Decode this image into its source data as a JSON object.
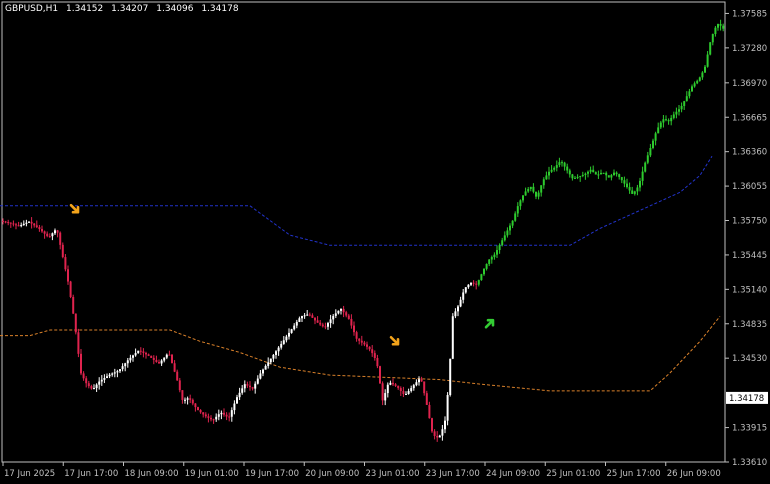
{
  "header": {
    "symbol": "GBPUSD,H1",
    "open": "1.34152",
    "high": "1.34207",
    "low": "1.34096",
    "close": "1.34178"
  },
  "colors": {
    "background": "#000000",
    "axis": "#c0c0c0",
    "bull_candle": "#ffffff",
    "bear_candle": "#e0234e",
    "uptrend_candle": "#2ecc2e",
    "upper_band": "#2233cc",
    "lower_band": "#d9802a",
    "sell_arrow": "#f2a31b",
    "buy_arrow": "#33cc33",
    "price_tag_bg": "#ffffff",
    "price_tag_text": "#000000"
  },
  "chart_data": {
    "type": "candlestick",
    "ylim": [
      1.3361,
      1.3758
    ],
    "y_ticks": [
      "1.37585",
      "1.37280",
      "1.36970",
      "1.36665",
      "1.36360",
      "1.36055",
      "1.35750",
      "1.35445",
      "1.35140",
      "1.34835",
      "1.34530",
      "1.33915",
      "1.33610"
    ],
    "x_ticks": [
      "17 Jun 2025",
      "17 Jun 17:00",
      "18 Jun 09:00",
      "19 Jun 01:00",
      "19 Jun 17:00",
      "20 Jun 09:00",
      "23 Jun 01:00",
      "23 Jun 17:00",
      "24 Jun 09:00",
      "25 Jun 01:00",
      "25 Jun 17:00",
      "26 Jun 09:00"
    ],
    "current_price": "1.34178",
    "price_path": [
      [
        0,
        1.3575
      ],
      [
        10,
        1.3573
      ],
      [
        20,
        1.357
      ],
      [
        30,
        1.3574
      ],
      [
        40,
        1.3568
      ],
      [
        50,
        1.356
      ],
      [
        58,
        1.3568
      ],
      [
        64,
        1.3543
      ],
      [
        70,
        1.3518
      ],
      [
        76,
        1.3484
      ],
      [
        82,
        1.344
      ],
      [
        88,
        1.343
      ],
      [
        94,
        1.3425
      ],
      [
        100,
        1.3432
      ],
      [
        110,
        1.3438
      ],
      [
        120,
        1.3442
      ],
      [
        130,
        1.3452
      ],
      [
        140,
        1.346
      ],
      [
        150,
        1.3455
      ],
      [
        160,
        1.3448
      ],
      [
        170,
        1.3458
      ],
      [
        178,
        1.3435
      ],
      [
        184,
        1.3415
      ],
      [
        190,
        1.3418
      ],
      [
        198,
        1.3408
      ],
      [
        206,
        1.3402
      ],
      [
        214,
        1.3398
      ],
      [
        222,
        1.3405
      ],
      [
        230,
        1.34
      ],
      [
        238,
        1.3418
      ],
      [
        246,
        1.343
      ],
      [
        254,
        1.3426
      ],
      [
        262,
        1.344
      ],
      [
        270,
        1.345
      ],
      [
        278,
        1.346
      ],
      [
        286,
        1.347
      ],
      [
        294,
        1.348
      ],
      [
        302,
        1.349
      ],
      [
        310,
        1.3492
      ],
      [
        318,
        1.3485
      ],
      [
        326,
        1.348
      ],
      [
        334,
        1.349
      ],
      [
        342,
        1.3497
      ],
      [
        350,
        1.3488
      ],
      [
        358,
        1.347
      ],
      [
        366,
        1.3465
      ],
      [
        372,
        1.346
      ],
      [
        378,
        1.345
      ],
      [
        384,
        1.3415
      ],
      [
        390,
        1.3432
      ],
      [
        398,
        1.3428
      ],
      [
        406,
        1.342
      ],
      [
        414,
        1.3428
      ],
      [
        422,
        1.3436
      ],
      [
        428,
        1.3412
      ],
      [
        434,
        1.3385
      ],
      [
        440,
        1.3382
      ],
      [
        446,
        1.3395
      ],
      [
        450,
        1.343
      ],
      [
        454,
        1.349
      ],
      [
        460,
        1.35
      ],
      [
        466,
        1.3515
      ],
      [
        472,
        1.352
      ],
      [
        478,
        1.3518
      ],
      [
        484,
        1.353
      ],
      [
        490,
        1.354
      ],
      [
        496,
        1.3545
      ],
      [
        502,
        1.3555
      ],
      [
        508,
        1.3565
      ],
      [
        514,
        1.3575
      ],
      [
        520,
        1.359
      ],
      [
        526,
        1.36
      ],
      [
        532,
        1.3605
      ],
      [
        538,
        1.3595
      ],
      [
        544,
        1.361
      ],
      [
        550,
        1.3618
      ],
      [
        556,
        1.3622
      ],
      [
        562,
        1.3628
      ],
      [
        568,
        1.362
      ],
      [
        574,
        1.3612
      ],
      [
        580,
        1.3614
      ],
      [
        586,
        1.3616
      ],
      [
        592,
        1.362
      ],
      [
        598,
        1.3615
      ],
      [
        604,
        1.3618
      ],
      [
        610,
        1.3613
      ],
      [
        616,
        1.3618
      ],
      [
        622,
        1.3612
      ],
      [
        628,
        1.3605
      ],
      [
        634,
        1.3598
      ],
      [
        640,
        1.3606
      ],
      [
        646,
        1.3625
      ],
      [
        652,
        1.364
      ],
      [
        658,
        1.3655
      ],
      [
        664,
        1.3665
      ],
      [
        670,
        1.3663
      ],
      [
        676,
        1.367
      ],
      [
        682,
        1.3675
      ],
      [
        688,
        1.3685
      ],
      [
        694,
        1.3695
      ],
      [
        700,
        1.37
      ],
      [
        706,
        1.371
      ],
      [
        712,
        1.3735
      ],
      [
        716,
        1.3745
      ],
      [
        720,
        1.375
      ],
      [
        724,
        1.3745
      ]
    ],
    "uptrend_start_x": 478,
    "upper_band": [
      [
        0,
        1.3588
      ],
      [
        250,
        1.3588
      ],
      [
        270,
        1.3575
      ],
      [
        290,
        1.3562
      ],
      [
        330,
        1.3553
      ],
      [
        570,
        1.3553
      ],
      [
        600,
        1.3568
      ],
      [
        640,
        1.3584
      ],
      [
        680,
        1.36
      ],
      [
        700,
        1.3615
      ],
      [
        712,
        1.3632
      ]
    ],
    "lower_band": [
      [
        0,
        1.3473
      ],
      [
        30,
        1.3473
      ],
      [
        50,
        1.3478
      ],
      [
        170,
        1.3478
      ],
      [
        200,
        1.3468
      ],
      [
        240,
        1.3458
      ],
      [
        280,
        1.3445
      ],
      [
        330,
        1.3438
      ],
      [
        440,
        1.3434
      ],
      [
        480,
        1.343
      ],
      [
        550,
        1.3424
      ],
      [
        650,
        1.3424
      ],
      [
        670,
        1.344
      ],
      [
        700,
        1.3468
      ],
      [
        720,
        1.349
      ]
    ],
    "markers": [
      {
        "type": "sell",
        "x": 75,
        "price": 1.3585
      },
      {
        "type": "sell",
        "x": 395,
        "price": 1.3468
      },
      {
        "type": "buy",
        "x": 490,
        "price": 1.3484
      }
    ]
  }
}
